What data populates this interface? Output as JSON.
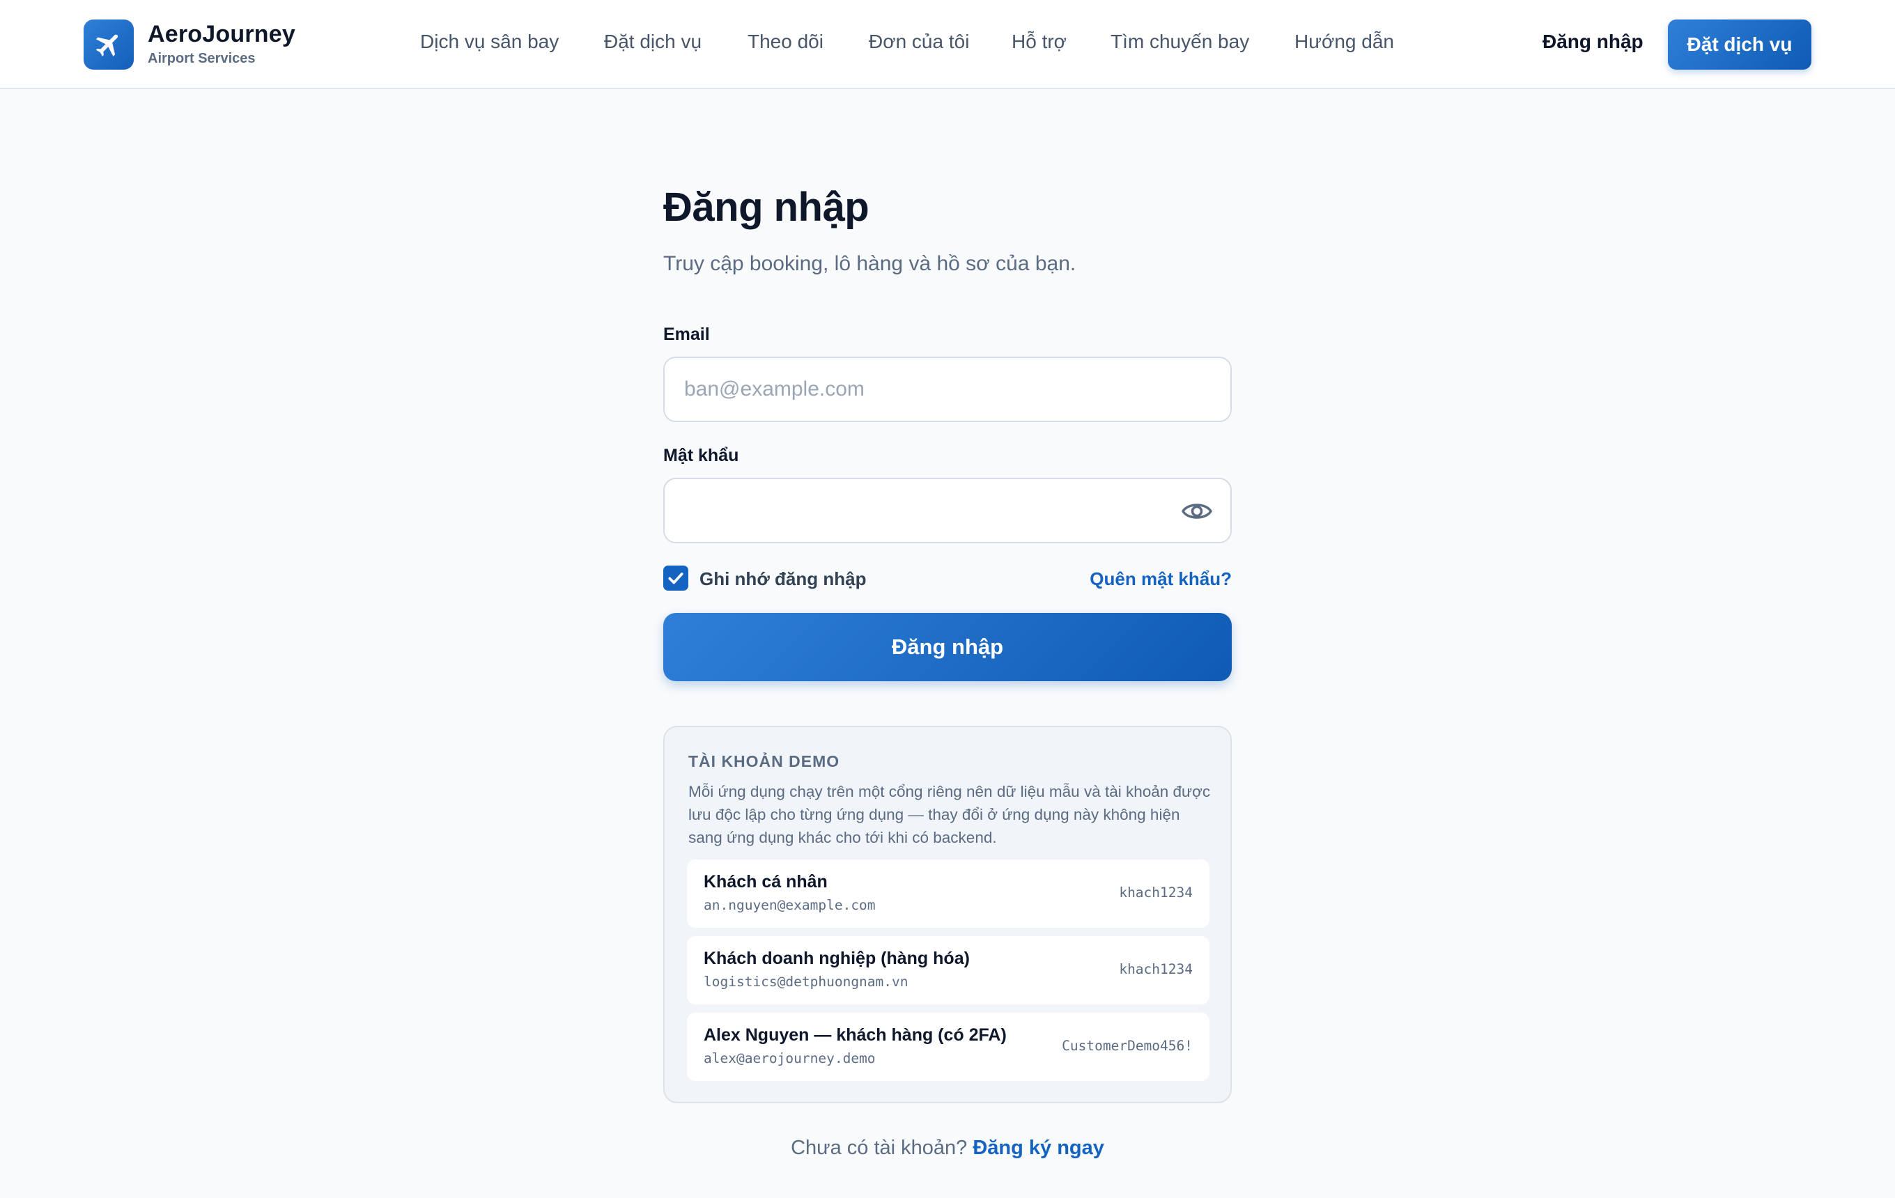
{
  "brand": {
    "name": "AeroJourney",
    "subtitle": "Airport Services",
    "logo_icon": "airplane-icon",
    "accent_color": "#1463c1"
  },
  "nav": {
    "items": [
      {
        "label": "Dịch vụ sân bay"
      },
      {
        "label": "Đặt dịch vụ"
      },
      {
        "label": "Theo dõi"
      },
      {
        "label": "Đơn của tôi"
      },
      {
        "label": "Hỗ trợ"
      },
      {
        "label": "Tìm chuyến bay"
      },
      {
        "label": "Hướng dẫn"
      }
    ],
    "login_label": "Đăng nhập",
    "book_label": "Đặt dịch vụ"
  },
  "login": {
    "title": "Đăng nhập",
    "subtitle": "Truy cập booking, lô hàng và hồ sơ của bạn.",
    "email_label": "Email",
    "email_placeholder": "ban@example.com",
    "email_value": "",
    "password_label": "Mật khẩu",
    "password_value": "",
    "password_toggle_icon": "eye-icon",
    "remember_label": "Ghi nhớ đăng nhập",
    "remember_checked": true,
    "forgot_label": "Quên mật khẩu?",
    "submit_label": "Đăng nhập"
  },
  "demo": {
    "title": "TÀI KHOẢN DEMO",
    "description": "Mỗi ứng dụng chạy trên một cổng riêng nên dữ liệu mẫu và tài khoản được lưu độc lập cho từng ứng dụng — thay đổi ở ứng dụng này không hiện sang ứng dụng khác cho tới khi có backend.",
    "accounts": [
      {
        "name": "Khách cá nhân",
        "email": "an.nguyen@example.com",
        "password": "khach1234"
      },
      {
        "name": "Khách doanh nghiệp (hàng hóa)",
        "email": "logistics@detphuongnam.vn",
        "password": "khach1234"
      },
      {
        "name": "Alex Nguyen — khách hàng (có 2FA)",
        "email": "alex@aerojourney.demo",
        "password": "CustomerDemo456!"
      }
    ]
  },
  "signup": {
    "prompt": "Chưa có tài khoản?",
    "link_label": "Đăng ký ngay"
  }
}
